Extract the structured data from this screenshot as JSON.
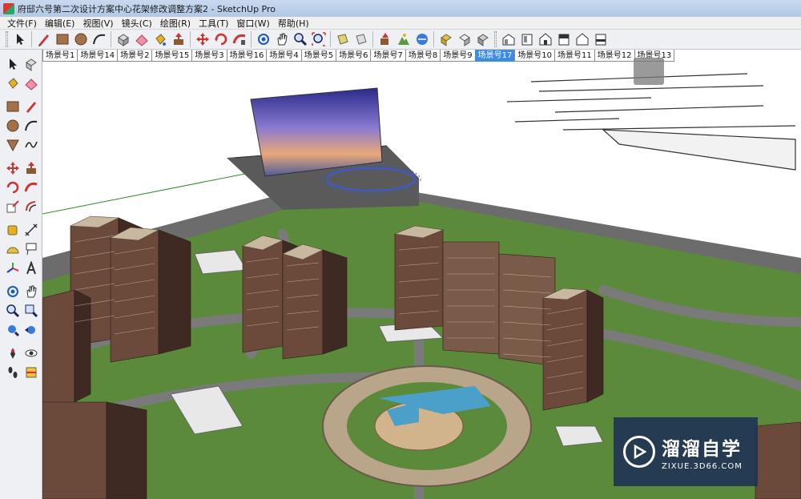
{
  "window": {
    "title": "府邸六号第二次设计方案中心花架修改调整方案2 - SketchUp Pro"
  },
  "menu": [
    {
      "label": "文件(F)"
    },
    {
      "label": "编辑(E)"
    },
    {
      "label": "视图(V)"
    },
    {
      "label": "镜头(C)"
    },
    {
      "label": "绘图(R)"
    },
    {
      "label": "工具(T)"
    },
    {
      "label": "窗口(W)"
    },
    {
      "label": "帮助(H)"
    }
  ],
  "top_toolbar": [
    "select-icon",
    "pencil-icon",
    "rectangle-icon",
    "circle-icon",
    "arc-icon",
    "make-component-icon",
    "eraser-icon",
    "paint-bucket-icon",
    "push-pull-icon",
    "move-icon",
    "rotate-icon",
    "follow-me-icon",
    "offset-icon",
    "orbit-icon",
    "pan-icon",
    "zoom-icon",
    "zoom-extents-icon",
    "previous-view-icon",
    "next-view-icon",
    "add-location-icon",
    "toggle-terrain-icon",
    "get-models-icon",
    "share-model-icon",
    "components-icon",
    "iso-view-icon",
    "top-view-icon",
    "front-view-icon",
    "right-view-icon",
    "back-view-icon",
    "left-view-icon"
  ],
  "left_toolbar": [
    "select-icon",
    "make-component-icon",
    "paint-bucket-icon",
    "eraser-icon",
    "rectangle-icon",
    "line-icon",
    "circle-icon",
    "arc-icon",
    "polygon-icon",
    "freehand-icon",
    "move-icon",
    "push-pull-icon",
    "rotate-icon",
    "follow-me-icon",
    "scale-icon",
    "offset-icon",
    "tape-measure-icon",
    "dimension-icon",
    "protractor-icon",
    "text-icon",
    "axes-icon",
    "3d-text-icon",
    "orbit-icon",
    "pan-icon",
    "zoom-icon",
    "zoom-window-icon",
    "zoom-extents-icon",
    "previous-view-icon",
    "position-camera-icon",
    "look-around-icon",
    "walk-icon",
    "section-plane-icon"
  ],
  "scene_tabs": [
    {
      "label": "场景号1"
    },
    {
      "label": "场景号14"
    },
    {
      "label": "场景号2"
    },
    {
      "label": "场景号15"
    },
    {
      "label": "场景号3"
    },
    {
      "label": "场景号16"
    },
    {
      "label": "场景号4"
    },
    {
      "label": "场景号5"
    },
    {
      "label": "场景号6"
    },
    {
      "label": "场景号7"
    },
    {
      "label": "场景号8"
    },
    {
      "label": "场景号9"
    },
    {
      "label": "场景号17",
      "active": true
    },
    {
      "label": "场景号10"
    },
    {
      "label": "场景号11"
    },
    {
      "label": "场景号12"
    },
    {
      "label": "场景号13"
    }
  ],
  "watermark": {
    "name": "溜溜自学",
    "url": "ZIXUE.3D66.COM"
  },
  "colors": {
    "accent": "#3c8de0",
    "grass": "#5b8a3a",
    "road": "#6e6e6e",
    "building": "#5a3a30",
    "sky_panel": "#7a7ac8"
  }
}
